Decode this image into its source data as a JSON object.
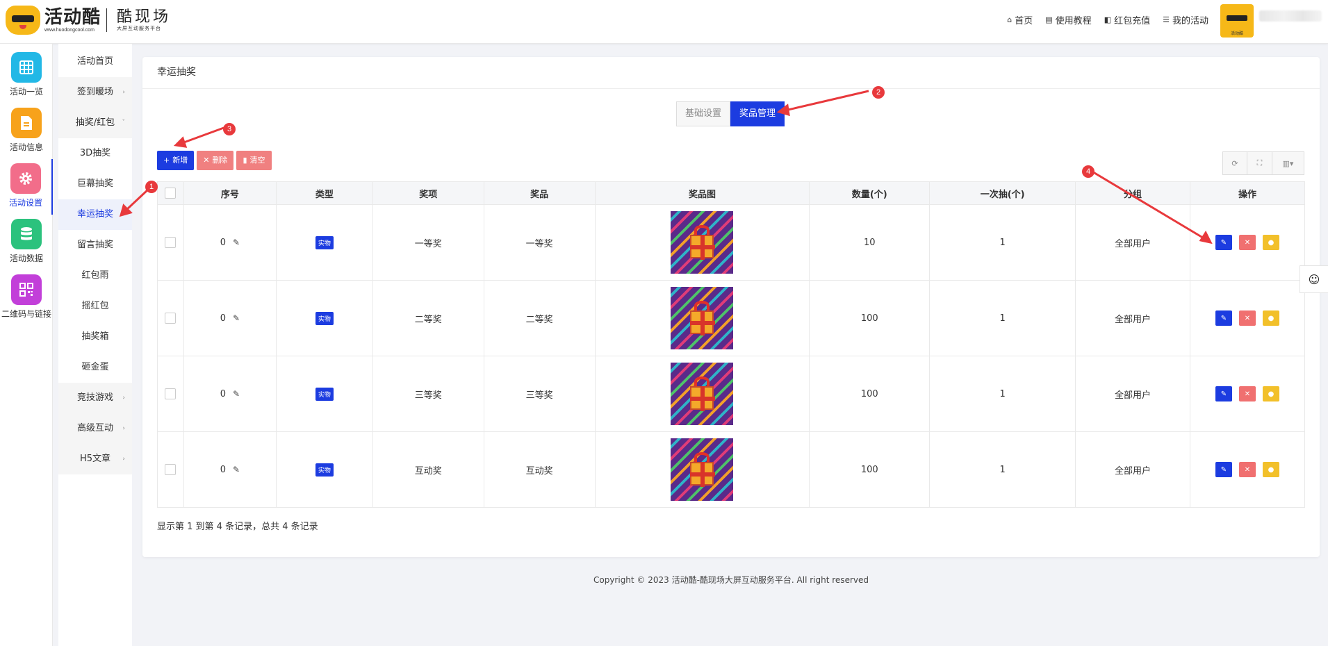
{
  "header": {
    "logo_main": "活动酷",
    "logo_url": "www.huodongcool.com",
    "logo_sub_main": "酷现场",
    "logo_sub_small": "大屏互动服务平台",
    "nav": [
      {
        "label": "首页",
        "icon": "home-icon"
      },
      {
        "label": "使用教程",
        "icon": "document-icon"
      },
      {
        "label": "红包充值",
        "icon": "wallet-icon"
      },
      {
        "label": "我的活动",
        "icon": "list-icon"
      }
    ],
    "avatar_label": "活动酷"
  },
  "rail": {
    "items": [
      {
        "label": "活动一览",
        "color": "#22b8e6",
        "icon": "grid-icon"
      },
      {
        "label": "活动信息",
        "color": "#f7a21b",
        "icon": "document-icon"
      },
      {
        "label": "活动设置",
        "color": "#f26d8a",
        "icon": "gear-icon"
      },
      {
        "label": "活动数据",
        "color": "#2bc27d",
        "icon": "database-icon"
      },
      {
        "label": "二维码与链接",
        "color": "#c23fd9",
        "icon": "qrcode-icon"
      }
    ]
  },
  "submenu": {
    "items": [
      {
        "label": "活动首页"
      },
      {
        "label": "签到暖场",
        "arrow": "›"
      },
      {
        "label": "抽奖/红包",
        "arrow": "ˇ"
      },
      {
        "label": "3D抽奖"
      },
      {
        "label": "巨幕抽奖"
      },
      {
        "label": "幸运抽奖"
      },
      {
        "label": "留言抽奖"
      },
      {
        "label": "红包雨"
      },
      {
        "label": "摇红包"
      },
      {
        "label": "抽奖箱"
      },
      {
        "label": "砸金蛋"
      },
      {
        "label": "竞技游戏",
        "arrow": "›"
      },
      {
        "label": "高级互动",
        "arrow": "›"
      },
      {
        "label": "H5文章",
        "arrow": "›"
      }
    ]
  },
  "card": {
    "title": "幸运抽奖",
    "tabs": [
      "基础设置",
      "奖品管理"
    ],
    "toolbar": {
      "add": "新增",
      "delete": "删除",
      "clear": "清空"
    },
    "columns": [
      "序号",
      "类型",
      "奖项",
      "奖品",
      "奖品图",
      "数量(个)",
      "一次抽(个)",
      "分组",
      "操作"
    ],
    "rows": [
      {
        "seq": "0",
        "type": "实物",
        "award": "一等奖",
        "prize": "一等奖",
        "qty": "10",
        "per_draw": "1",
        "group": "全部用户"
      },
      {
        "seq": "0",
        "type": "实物",
        "award": "二等奖",
        "prize": "二等奖",
        "qty": "100",
        "per_draw": "1",
        "group": "全部用户"
      },
      {
        "seq": "0",
        "type": "实物",
        "award": "三等奖",
        "prize": "三等奖",
        "qty": "100",
        "per_draw": "1",
        "group": "全部用户"
      },
      {
        "seq": "0",
        "type": "实物",
        "award": "互动奖",
        "prize": "互动奖",
        "qty": "100",
        "per_draw": "1",
        "group": "全部用户"
      }
    ],
    "summary": "显示第 1 到第 4 条记录，总共 4 条记录"
  },
  "footer": "Copyright © 2023 活动酷-酷现场大屏互动服务平台. All right reserved",
  "annotations": [
    "1",
    "2",
    "3",
    "4"
  ],
  "colors": {
    "accent": "#1c3ce0",
    "danger": "#f07070",
    "warning": "#f2c02a",
    "marker": "#e8393c"
  }
}
